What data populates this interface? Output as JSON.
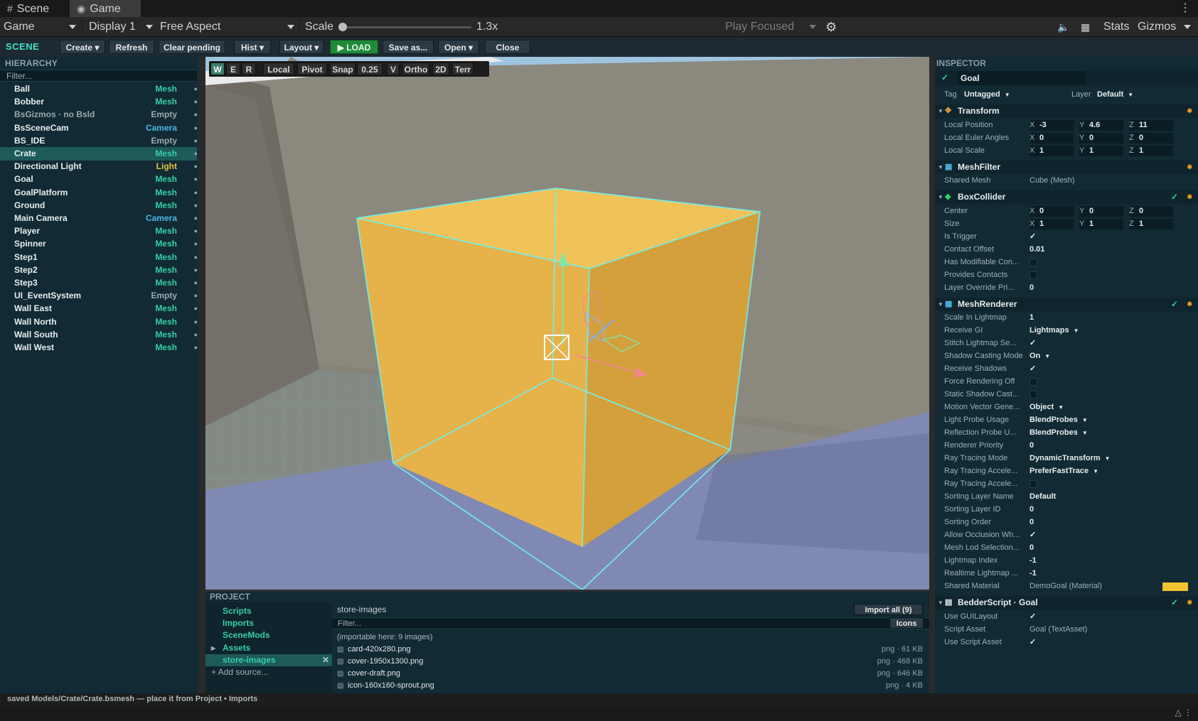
{
  "tabs": {
    "scene": "Scene",
    "game": "Game"
  },
  "game_toolbar": {
    "display_mode": "Game",
    "display": "Display 1",
    "aspect": "Free Aspect",
    "scale_label": "Scale",
    "scale_value": "1.3x",
    "play_focused": "Play Focused",
    "stats": "Stats",
    "gizmos": "Gizmos"
  },
  "scene_toolbar": {
    "title": "SCENE",
    "create": "Create ▾",
    "refresh": "Refresh",
    "clear_pending": "Clear pending",
    "hist": "Hist ▾",
    "layout": "Layout ▾",
    "load": "▶ LOAD",
    "save_as": "Save as...",
    "open": "Open ▾",
    "close": "Close"
  },
  "hierarchy": {
    "title": "HIERARCHY",
    "filter_placeholder": "Filter...",
    "items": [
      {
        "name": "Ball",
        "type": "Mesh"
      },
      {
        "name": "Bobber",
        "type": "Mesh"
      },
      {
        "name": "BsGizmos · no Bsld",
        "type": "Empty"
      },
      {
        "name": "BsSceneCam",
        "type": "Camera"
      },
      {
        "name": "BS_IDE",
        "type": "Empty"
      },
      {
        "name": "Crate",
        "type": "Mesh"
      },
      {
        "name": "Directional Light",
        "type": "Light"
      },
      {
        "name": "Goal",
        "type": "Mesh"
      },
      {
        "name": "GoalPlatform",
        "type": "Mesh"
      },
      {
        "name": "Ground",
        "type": "Mesh"
      },
      {
        "name": "Main Camera",
        "type": "Camera"
      },
      {
        "name": "Player",
        "type": "Mesh"
      },
      {
        "name": "Spinner",
        "type": "Mesh"
      },
      {
        "name": "Step1",
        "type": "Mesh"
      },
      {
        "name": "Step2",
        "type": "Mesh"
      },
      {
        "name": "Step3",
        "type": "Mesh"
      },
      {
        "name": "UI_EventSystem",
        "type": "Empty"
      },
      {
        "name": "Wall East",
        "type": "Mesh"
      },
      {
        "name": "Wall North",
        "type": "Mesh"
      },
      {
        "name": "Wall South",
        "type": "Mesh"
      },
      {
        "name": "Wall West",
        "type": "Mesh"
      }
    ]
  },
  "viewport_toolbar": {
    "w": "W",
    "e": "E",
    "r": "R",
    "local": "Local",
    "pivot": "Pivot",
    "snap": "Snap",
    "snap_value": "0.25",
    "v": "V",
    "ortho": "Ortho",
    "twod": "2D",
    "terr": "Terr"
  },
  "project": {
    "title": "PROJECT",
    "sources": [
      "Scripts",
      "Imports",
      "SceneMods",
      "Assets",
      "store-images"
    ],
    "add_source": "+ Add source...",
    "path": "store-images",
    "import_all": "Import all (9)",
    "filter_placeholder": "Filter...",
    "icons": "Icons",
    "note": "(importable here: 9 images)",
    "files": [
      {
        "name": "card-420x280.png",
        "size": "png · 61 KB"
      },
      {
        "name": "cover-1950x1300.png",
        "size": "png · 468 KB"
      },
      {
        "name": "cover-draft.png",
        "size": "png · 646 KB"
      },
      {
        "name": "icon-160x160-sprout.png",
        "size": "png · 4 KB"
      }
    ]
  },
  "inspector": {
    "title": "INSPECTOR",
    "object_name": "Goal",
    "tag_label": "Tag",
    "tag_value": "Untagged",
    "layer_label": "Layer",
    "layer_value": "Default",
    "transform": {
      "title": "Transform",
      "pos_label": "Local Position",
      "pos": [
        "-3",
        "4.6",
        "11"
      ],
      "rot_label": "Local Euler Angles",
      "rot": [
        "0",
        "0",
        "0"
      ],
      "scale_label": "Local Scale",
      "scale": [
        "1",
        "1",
        "1"
      ]
    },
    "meshfilter": {
      "title": "MeshFilter",
      "shared_mesh_label": "Shared Mesh",
      "shared_mesh": "Cube  (Mesh)"
    },
    "boxcollider": {
      "title": "BoxCollider",
      "center_label": "Center",
      "center": [
        "0",
        "0",
        "0"
      ],
      "size_label": "Size",
      "size": [
        "1",
        "1",
        "1"
      ],
      "is_trigger": "Is Trigger",
      "contact_offset_label": "Contact Offset",
      "contact_offset": "0.01",
      "has_modifiable": "Has Modifiable Con...",
      "provides_contacts": "Provides Contacts",
      "layer_override": "Layer Override Pri...",
      "layer_override_value": "0"
    },
    "meshrenderer": {
      "title": "MeshRenderer",
      "rows": [
        {
          "label": "Scale In Lightmap",
          "value": "1",
          "kind": "text"
        },
        {
          "label": "Receive GI",
          "value": "Lightmaps",
          "kind": "dropdown"
        },
        {
          "label": "Stitch Lightmap Se...",
          "value": "✓",
          "kind": "check"
        },
        {
          "label": "Shadow Casting Mode",
          "value": "On",
          "kind": "dropdown"
        },
        {
          "label": "Receive Shadows",
          "value": "✓",
          "kind": "check"
        },
        {
          "label": "Force Rendering Off",
          "value": "",
          "kind": "box"
        },
        {
          "label": "Static Shadow Cast...",
          "value": "",
          "kind": "box"
        },
        {
          "label": "Motion Vector Gene...",
          "value": "Object",
          "kind": "dropdown"
        },
        {
          "label": "Light Probe Usage",
          "value": "BlendProbes",
          "kind": "dropdown"
        },
        {
          "label": "Reflection Probe U...",
          "value": "BlendProbes",
          "kind": "dropdown"
        },
        {
          "label": "Renderer Priority",
          "value": "0",
          "kind": "text"
        },
        {
          "label": "Ray Tracing Mode",
          "value": "DynamicTransform",
          "kind": "dropdown"
        },
        {
          "label": "Ray Tracing Accele...",
          "value": "PreferFastTrace",
          "kind": "dropdown"
        },
        {
          "label": "Ray Tracing Accele...",
          "value": "",
          "kind": "box"
        },
        {
          "label": "Sorting Layer Name",
          "value": "Default",
          "kind": "text"
        },
        {
          "label": "Sorting Layer ID",
          "value": "0",
          "kind": "text"
        },
        {
          "label": "Sorting Order",
          "value": "0",
          "kind": "text"
        },
        {
          "label": "Allow Occlusion Wh...",
          "value": "✓",
          "kind": "check"
        },
        {
          "label": "Mesh Lod Selection...",
          "value": "0",
          "kind": "text"
        },
        {
          "label": "Lightmap Index",
          "value": "-1",
          "kind": "text"
        },
        {
          "label": "Realtime Lightmap ...",
          "value": "-1",
          "kind": "text"
        },
        {
          "label": "Shared Material",
          "value": "DemoGoal  (Material)",
          "kind": "material"
        }
      ]
    },
    "bedder": {
      "title": "BedderScript · Goal",
      "use_gui_label": "Use GUILayout",
      "script_asset_label": "Script Asset",
      "script_asset": "Goal  (TextAsset)",
      "use_script_label": "Use Script Asset"
    }
  },
  "status": "saved Models/Crate/Crate.bsmesh — place it from Project • Imports",
  "colors": {
    "accent": "#36cfa6",
    "selection": "#1e5a5a",
    "crate": "#e9b646",
    "material_swatch": "#f0c430"
  }
}
